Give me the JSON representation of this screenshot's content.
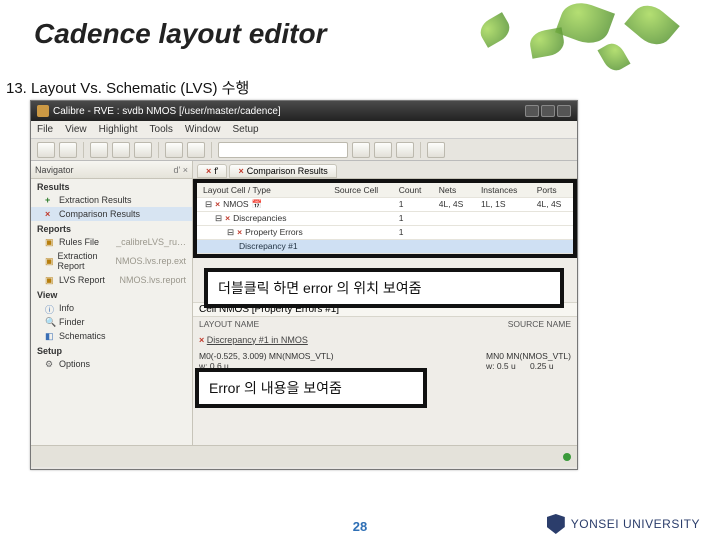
{
  "slide": {
    "title": "Cadence layout editor",
    "section": "13. Layout Vs. Schematic (LVS) 수행",
    "page_number": "28",
    "university": "YONSEI UNIVERSITY"
  },
  "window": {
    "title": "Calibre - RVE : svdb NMOS [/user/master/cadence]",
    "menubar": [
      "File",
      "View",
      "Highlight",
      "Tools",
      "Window",
      "Setup"
    ]
  },
  "navigator": {
    "panel_title": "Navigator",
    "collapse_label": "d' ×",
    "sections": {
      "results": "Results",
      "reports": "Reports",
      "view": "View",
      "setup": "Setup"
    },
    "results_items": [
      {
        "icon": "plus",
        "label": "Extraction Results"
      },
      {
        "icon": "x",
        "label": "Comparison Results"
      }
    ],
    "reports_items": [
      {
        "icon": "check",
        "label": "Rules File",
        "note": "_calibreLVS_ru…"
      },
      {
        "icon": "check",
        "label": "Extraction Report",
        "note": "NMOS.lvs.rep.ext"
      },
      {
        "icon": "check",
        "label": "LVS Report",
        "note": "NMOS.lvs.report"
      }
    ],
    "view_items": [
      {
        "label": "Info"
      },
      {
        "label": "Finder"
      },
      {
        "label": "Schematics"
      }
    ],
    "setup_items": [
      {
        "label": "Options"
      }
    ]
  },
  "tabs": {
    "tab1": "f'",
    "tab2": "Comparison Results"
  },
  "table": {
    "headers": [
      "Layout Cell / Type",
      "Source Cell",
      "Count",
      "Nets",
      "Instances",
      "Ports"
    ],
    "rows": [
      {
        "cell": "NMOS",
        "icon": "x",
        "indent": 0,
        "cols": [
          "1",
          "4L, 4S",
          "1L, 1S",
          "4L, 4S"
        ]
      },
      {
        "cell": "Discrepancies",
        "icon": "x",
        "indent": 1,
        "cols": [
          "1",
          "",
          "",
          ""
        ]
      },
      {
        "cell": "Property Errors",
        "icon": "x",
        "indent": 2,
        "cols": [
          "1",
          "",
          "",
          ""
        ]
      },
      {
        "cell": "Discrepancy #1",
        "icon": "none",
        "indent": 3,
        "selected": true,
        "cols": [
          "",
          "",
          "",
          ""
        ]
      }
    ]
  },
  "annotations": {
    "a1": "더블클릭 하면 error 의 위치 보여줌",
    "a2": "Error 의 내용을 보여줌"
  },
  "detail": {
    "cell_header": "Cell NMOS [Property Errors #1]",
    "layout_name_label": "LAYOUT NAME",
    "source_name_label": "SOURCE NAME",
    "discrepancy_line": "Discrepancy #1 in NMOS",
    "left": {
      "line1": "M0(-0.525, 3.009)  MN(NMOS_VTL)",
      "w": "w: 0.6 u"
    },
    "right": {
      "line1": "MN0  MN(NMOS_VTL)",
      "w": "w: 0.5 u",
      "extra": "0.25 u"
    }
  }
}
